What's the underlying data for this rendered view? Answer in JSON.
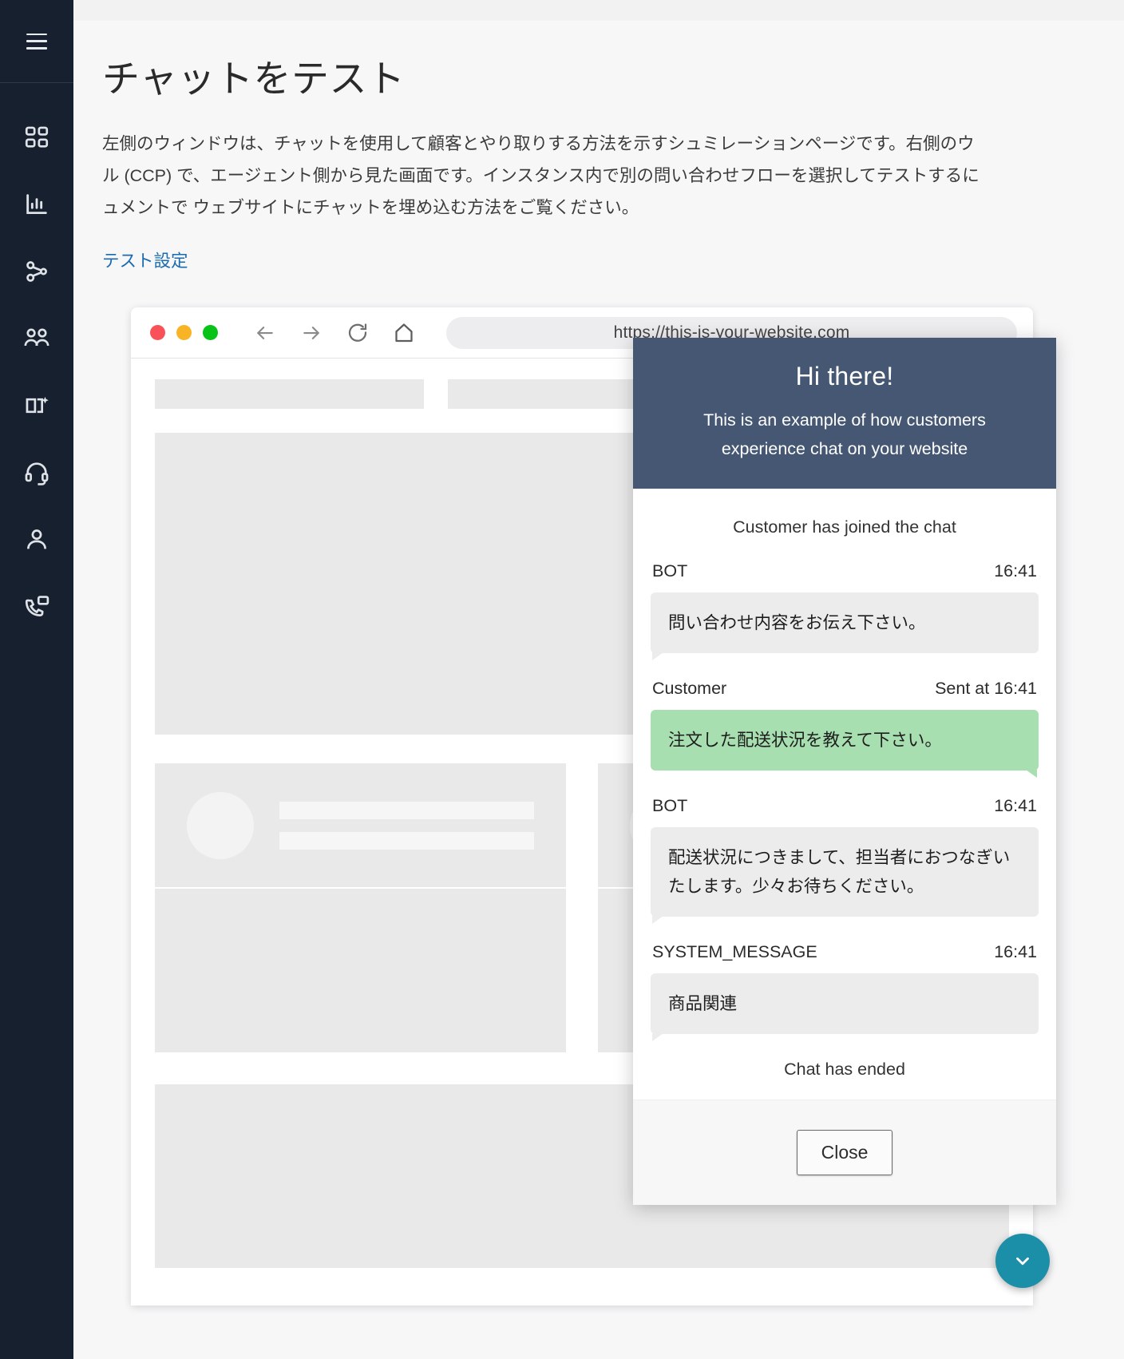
{
  "sidebar": {
    "menu_label": "menu",
    "items": [
      {
        "name": "dashboard",
        "icon": "grid-icon"
      },
      {
        "name": "analytics",
        "icon": "bar-chart-icon"
      },
      {
        "name": "routing",
        "icon": "flow-branch-icon"
      },
      {
        "name": "users",
        "icon": "users-icon"
      },
      {
        "name": "channels",
        "icon": "book-sparkle-icon"
      },
      {
        "name": "agent-desktop",
        "icon": "headset-icon"
      },
      {
        "name": "profile",
        "icon": "person-icon"
      },
      {
        "name": "contact-flows",
        "icon": "phone-chat-icon"
      }
    ]
  },
  "page": {
    "title": "チャットをテスト",
    "intro": "左側のウィンドウは、チャットを使用して顧客とやり取りする方法を示すシュミレーションページです。右側のウ\nル (CCP) で、エージェント側から見た画面です。インスタンス内で別の問い合わせフローを選択してテストするに\nュメントで ウェブサイトにチャットを埋め込む方法をご覧ください。",
    "test_settings_link": "テスト設定"
  },
  "browser": {
    "url": "https://this-is-your-website.com",
    "traffic_lights": [
      "close-red",
      "minimize-yellow",
      "maximize-green"
    ],
    "back_label": "戻る",
    "forward_label": "進む",
    "reload_label": "再読み込み",
    "home_label": "ホーム"
  },
  "chat": {
    "header": {
      "title": "Hi there!",
      "subtitle": "This is an example of how customers experience chat on your website"
    },
    "system_join": "Customer has joined the chat",
    "messages": [
      {
        "sender": "BOT",
        "time": "16:41",
        "prefix": "",
        "text": "問い合わせ内容をお伝え下さい。",
        "side": "in"
      },
      {
        "sender": "Customer",
        "time": "16:41",
        "prefix": "Sent at ",
        "text": "注文した配送状況を教えて下さい。",
        "side": "out"
      },
      {
        "sender": "BOT",
        "time": "16:41",
        "prefix": "",
        "text": "配送状況につきまして、担当者におつなぎいたします。少々お待ちください。",
        "side": "in"
      },
      {
        "sender": "SYSTEM_MESSAGE",
        "time": "16:41",
        "prefix": "",
        "text": "商品関連",
        "side": "in"
      }
    ],
    "chat_ended": "Chat has ended",
    "close_button": "Close"
  },
  "fab": {
    "icon": "chevron-down-icon",
    "color": "#1c8fa8"
  },
  "colors": {
    "sidebar_bg": "#16202f",
    "chat_header_bg": "#455772",
    "customer_bubble": "#a8dfb0",
    "bot_bubble": "#ececec",
    "link": "#1b6bb0"
  }
}
